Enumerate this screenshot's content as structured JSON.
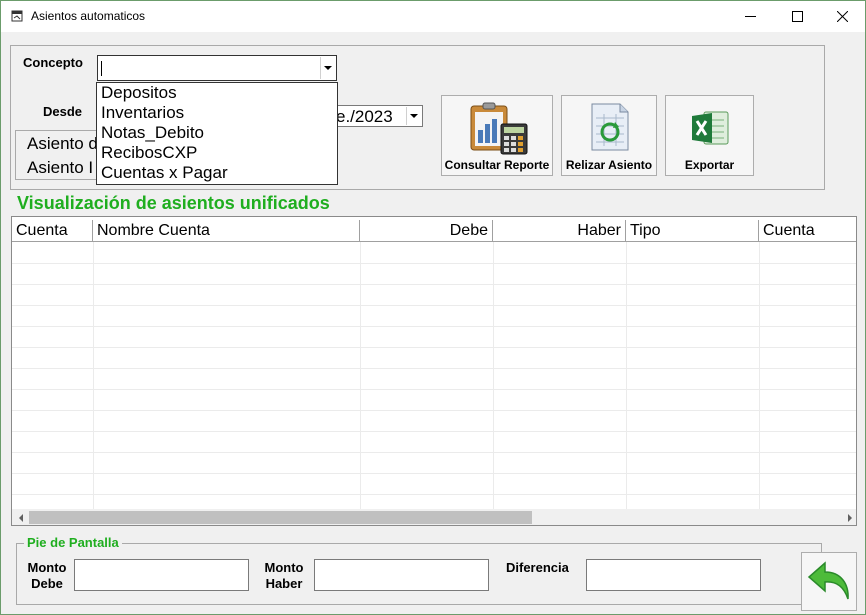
{
  "window": {
    "title": "Asientos automaticos"
  },
  "filters": {
    "concepto_label": "Concepto",
    "concepto_value": "",
    "concepto_options": [
      "Depositos",
      "Inventarios",
      "Notas_Debito",
      "RecibosCXP",
      "Cuentas x Pagar"
    ],
    "desde_label": "Desde",
    "desde_value": "e./2023"
  },
  "asientos": [
    "Asiento d",
    "Asiento I"
  ],
  "toolbar": {
    "consultar_label": "Consultar Reporte",
    "realizar_label": "Relizar Asiento",
    "exportar_label": "Exportar"
  },
  "grid": {
    "title": "Visualización de asientos unificados",
    "columns": [
      "Cuenta",
      "Nombre Cuenta",
      "Debe",
      "Haber",
      "Tipo",
      "Cuenta"
    ]
  },
  "footer": {
    "legend": "Pie de Pantalla",
    "monto_debe_label": [
      "Monto",
      "Debe"
    ],
    "monto_haber_label": [
      "Monto",
      "Haber"
    ],
    "diferencia_label": "Diferencia"
  }
}
